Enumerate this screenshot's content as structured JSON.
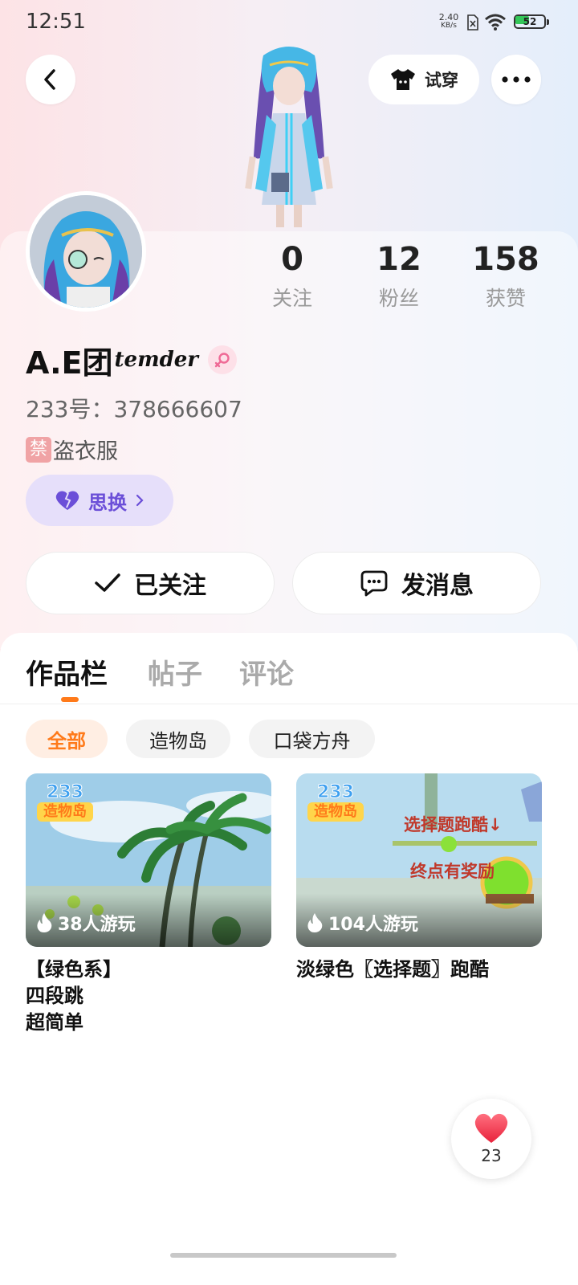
{
  "status_bar": {
    "time": "12:51",
    "net_speed": "2.40",
    "net_unit": "KB/s",
    "battery": "52",
    "battery_level": 0.52
  },
  "header": {
    "try_on_label": "试穿"
  },
  "profile": {
    "stats": [
      {
        "value": "0",
        "label": "关注"
      },
      {
        "value": "12",
        "label": "粉丝"
      },
      {
        "value": "158",
        "label": "获赞"
      }
    ],
    "name": "A.E团",
    "name_script": "temder",
    "id_text": "233号：378666607",
    "bio_icon": "禁",
    "bio_text": "盗衣服",
    "tag_label": "思换",
    "follow_label": "已关注",
    "message_label": "发消息"
  },
  "tabs": [
    {
      "label": "作品栏",
      "active": true
    },
    {
      "label": "帖子",
      "active": false
    },
    {
      "label": "评论",
      "active": false
    }
  ],
  "filters": [
    {
      "label": "全部",
      "active": true
    },
    {
      "label": "造物岛",
      "active": false
    },
    {
      "label": "口袋方舟",
      "active": false
    }
  ],
  "works": [
    {
      "logo_top": "233",
      "logo_bottom": "造物岛",
      "plays": "38人游玩",
      "title_lines": [
        "【绿色系】",
        "四段跳",
        "超简单"
      ]
    },
    {
      "logo_top": "233",
      "logo_bottom": "造物岛",
      "plays": "104人游玩",
      "overlay_line1": "选择题跑酷↓",
      "overlay_line2": "终点有奖励",
      "title_lines": [
        "淡绿色〖选择题〗跑酷"
      ]
    }
  ],
  "like_fab": {
    "count": "23"
  },
  "colors": {
    "accent": "#ff7a1a",
    "tag_purple": "#6b4fd8",
    "chip_active_bg": "#ffeee3"
  }
}
